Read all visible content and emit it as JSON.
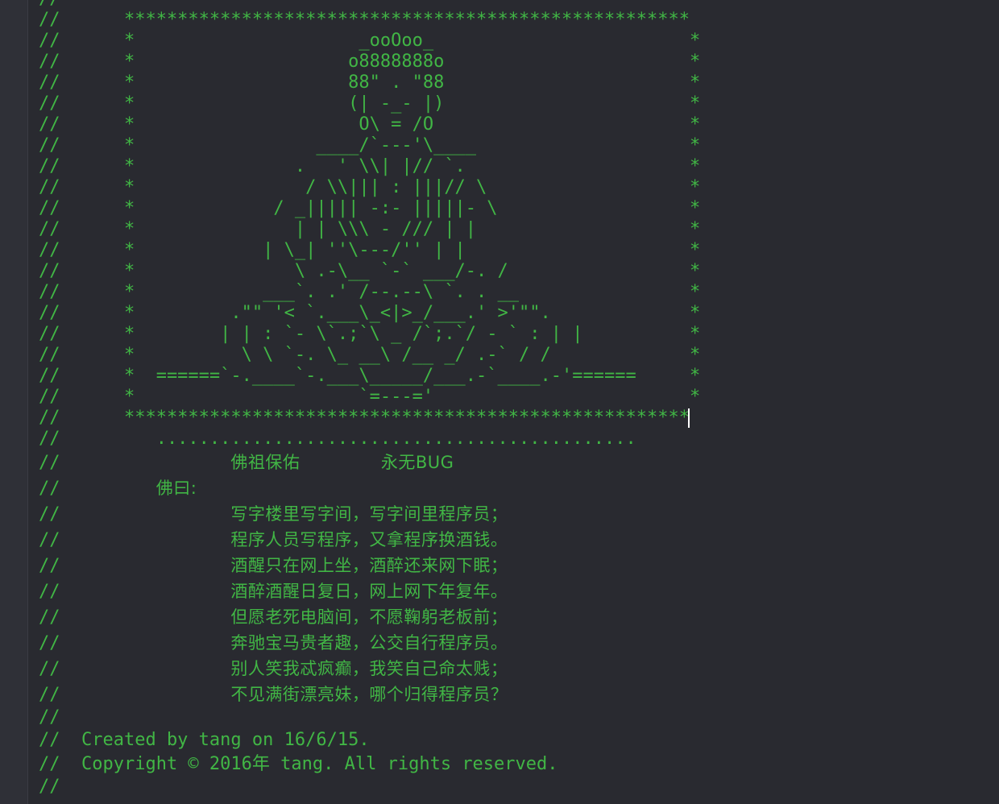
{
  "editor": {
    "lines": [
      "//",
      "//      *****************************************************",
      "//      *                     _ooOoo_                        *",
      "//      *                    o8888888o                       *",
      "//      *                    88\" . \"88                       *",
      "//      *                    (| -_- |)                       *",
      "//      *                     O\\ = /O                        *",
      "//      *                 ____/`---'\\____                    *",
      "//      *               .   ' \\\\| |// `.                     *",
      "//      *                / \\\\||| : |||// \\                   *",
      "//      *             / _||||| -:- |||||- \\                  *",
      "//      *               | | \\\\\\ - /// | |                    *",
      "//      *            | \\_| ''\\---/'' | |                     *",
      "//      *               \\ .-\\__ `-` ___/-. /                 *",
      "//      *            ___`. .' /--.--\\ `. . __                *",
      "//      *         .\"\" '< `.___\\_<|>_/___.' >'\"\".             *",
      "//      *        | | : `- \\`.;`\\ _ /`;.`/ - ` : | |          *",
      "//      *          \\ \\ `-. \\_ __\\ /__ _/ .-` / /             *",
      "//      *  ======`-.____`-.___\\_____/___.-`____.-'======     *",
      "//      *                     `=---='                        *"
    ],
    "border_bottom": "//      *****************************************************",
    "dots_line": "//         .............................................",
    "blessing": {
      "prefix": "//                ",
      "text": "佛祖保佑              永无BUG"
    },
    "buddha_says": {
      "prefix": "//         ",
      "text": "佛曰:"
    },
    "poem": [
      "写字楼里写字间，写字间里程序员；",
      "程序人员写程序，又拿程序换酒钱。",
      "酒醒只在网上坐，酒醉还来网下眠；",
      "酒醉酒醒日复日，网上网下年复年。",
      "但愿老死电脑间，不愿鞠躬老板前；",
      "奔驰宝马贵者趣，公交自行程序员。",
      "别人笑我忒疯癫，我笑自己命太贱；",
      "不见满街漂亮妹，哪个归得程序员？"
    ],
    "poem_prefix": "//                ",
    "blank_comment": "//",
    "created_line": "//  Created by tang on 16/6/15.",
    "copyright_line": "//  Copyright © 2016年 tang. All rights reserved.",
    "last_line": "//"
  },
  "colors": {
    "background": "#292a30",
    "gutter": "#2f3037",
    "comment_green": "#41b645",
    "caret": "#ffffff"
  }
}
